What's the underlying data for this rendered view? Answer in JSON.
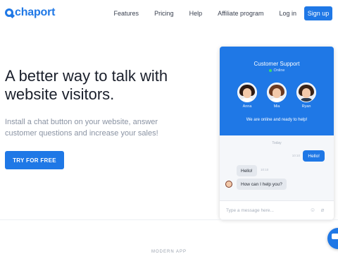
{
  "header": {
    "logo_text": "chaport",
    "nav": [
      "Features",
      "Pricing",
      "Help",
      "Affiliate program",
      "Log in"
    ],
    "signup_label": "Sign up"
  },
  "hero": {
    "headline": "A better way to talk with website visitors.",
    "subtext": "Install a chat button on your website, answer customer questions and increase your sales!",
    "cta_label": "TRY FOR FREE"
  },
  "widget": {
    "title": "Customer Support",
    "status": "Online",
    "agents": [
      {
        "name": "Anna",
        "hair": "#2d1a14",
        "shirt": "#ffffff"
      },
      {
        "name": "Mia",
        "hair": "#6a3a22",
        "shirt": "#ffffff"
      },
      {
        "name": "Ryan",
        "hair": "#3a2418",
        "shirt": "#2b3a4e"
      }
    ],
    "online_text": "We are online and ready to help!",
    "day_label": "Today",
    "messages": [
      {
        "from": "visitor",
        "text": "Hello!",
        "time": "10:10"
      },
      {
        "from": "agent",
        "text": "Hello!",
        "time": "10:10"
      },
      {
        "from": "agent",
        "text": "How can I help you?",
        "time": ""
      }
    ],
    "input_placeholder": "Type a message here..."
  },
  "footer": {
    "modern_label": "MODERN APP"
  },
  "colors": {
    "accent": "#1f78e6",
    "online": "#39d96a"
  }
}
